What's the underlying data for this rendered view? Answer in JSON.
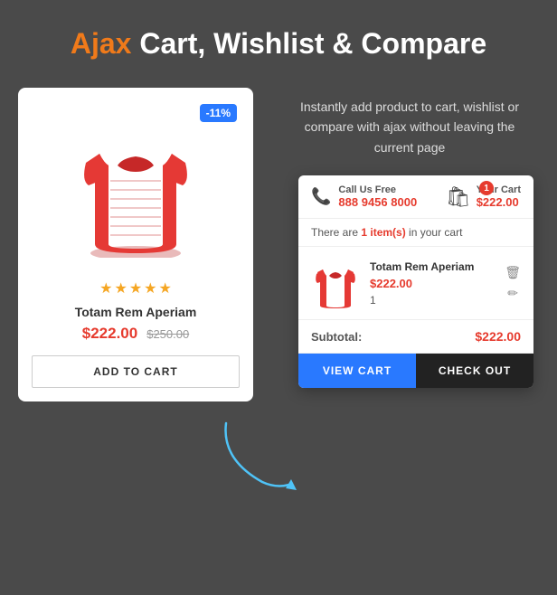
{
  "header": {
    "ajax_word": "Ajax",
    "title_rest": " Cart, Wishlist & Compare"
  },
  "description": "Instantly add product to cart, wishlist or compare with ajax without leaving the current page",
  "product": {
    "discount_badge": "-11%",
    "name": "Totam Rem Aperiam",
    "price_current": "$222.00",
    "price_old": "$250.00",
    "add_to_cart_label": "ADD TO CART",
    "stars": 5
  },
  "cart_popup": {
    "call_us_label": "Call Us Free",
    "call_us_number": "888 9456 8000",
    "cart_label": "Your Cart",
    "cart_total": "$222.00",
    "cart_count": "1",
    "items_info_prefix": "There are ",
    "items_info_count": "1 item(s)",
    "items_info_suffix": " in your cart",
    "item": {
      "name": "Totam Rem Aperiam",
      "price": "$222.00",
      "qty": "1"
    },
    "subtotal_label": "Subtotal:",
    "subtotal_value": "$222.00",
    "view_cart_label": "VIEW CART",
    "checkout_label": "CHECK OUT"
  }
}
